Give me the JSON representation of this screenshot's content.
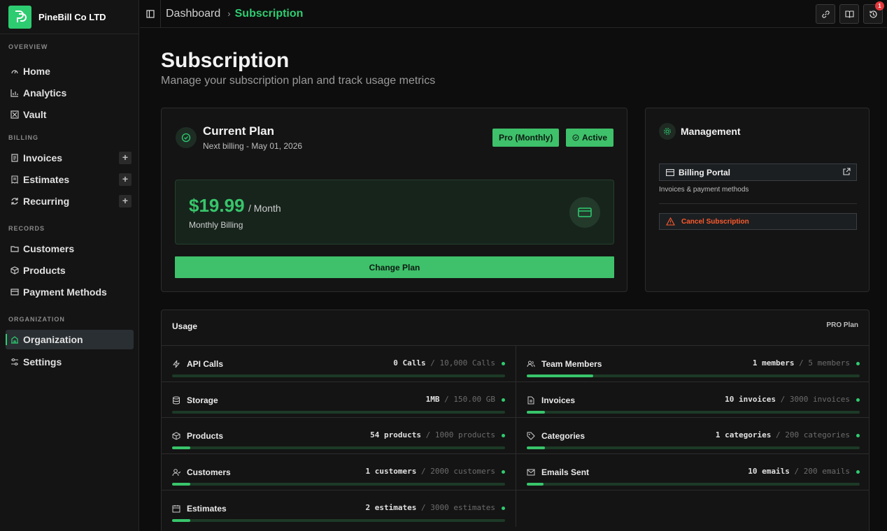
{
  "brand": {
    "name": "PineBill Co LTD"
  },
  "sidebar": {
    "sections": [
      {
        "title": "OVERVIEW",
        "items": [
          {
            "label": "Home",
            "icon": "gauge-icon"
          },
          {
            "label": "Analytics",
            "icon": "bar-chart-icon"
          },
          {
            "label": "Vault",
            "icon": "vault-icon"
          }
        ]
      },
      {
        "title": "BILLING",
        "items": [
          {
            "label": "Invoices",
            "icon": "file-icon",
            "add": "+"
          },
          {
            "label": "Estimates",
            "icon": "receipt-icon",
            "add": "+"
          },
          {
            "label": "Recurring",
            "icon": "refresh-icon",
            "add": "+"
          }
        ]
      },
      {
        "title": "RECORDS",
        "items": [
          {
            "label": "Customers",
            "icon": "folder-icon"
          },
          {
            "label": "Products",
            "icon": "box-icon"
          },
          {
            "label": "Payment Methods",
            "icon": "card-icon"
          }
        ]
      },
      {
        "title": "ORGANIZATION",
        "items": [
          {
            "label": "Organization",
            "icon": "building-icon",
            "active": true
          },
          {
            "label": "Settings",
            "icon": "sliders-icon"
          }
        ]
      }
    ]
  },
  "topbar": {
    "breadcrumb": {
      "home": "Dashboard",
      "separator": "›",
      "current": "Subscription"
    },
    "notification_count": "1"
  },
  "page": {
    "title": "Subscription",
    "subtitle": "Manage your subscription plan and track usage metrics"
  },
  "plan": {
    "title": "Current Plan",
    "next_billing": "Next billing - May 01, 2026",
    "plan_tag": "Pro (Monthly)",
    "status_tag": "Active",
    "price": "$19.99",
    "period": "/ Month",
    "billing_label": "Monthly Billing",
    "change_button": "Change Plan"
  },
  "management": {
    "title": "Management",
    "portal_button": "Billing Portal",
    "portal_desc": "Invoices & payment methods",
    "cancel_button": "Cancel Subscription"
  },
  "usage": {
    "title": "Usage",
    "plan_label": "PRO Plan",
    "metrics": [
      {
        "label": "API Calls",
        "icon": "bolt-icon",
        "value": "0 Calls",
        "limit": "10,000 Calls",
        "fraction": 0.0
      },
      {
        "label": "Team Members",
        "icon": "users-icon",
        "value": "1 members",
        "limit": "5 members",
        "fraction": 0.2
      },
      {
        "label": "Storage",
        "icon": "database-icon",
        "value": "1MB",
        "limit": "150.00 GB",
        "fraction": 0.0
      },
      {
        "label": "Invoices",
        "icon": "file-icon",
        "value": "10 invoices",
        "limit": "3000 invoices",
        "fraction": 0.003
      },
      {
        "label": "Products",
        "icon": "box-icon",
        "value": "54 products",
        "limit": "1000 products",
        "fraction": 0.054
      },
      {
        "label": "Categories",
        "icon": "tag-icon",
        "value": "1 categories",
        "limit": "200 categories",
        "fraction": 0.005
      },
      {
        "label": "Customers",
        "icon": "user-icon",
        "value": "1 customers",
        "limit": "2000 customers",
        "fraction": 0.0005
      },
      {
        "label": "Emails Sent",
        "icon": "mail-icon",
        "value": "10 emails",
        "limit": "200 emails",
        "fraction": 0.05
      },
      {
        "label": "Estimates",
        "icon": "receipt-icon",
        "value": "2 estimates",
        "limit": "3000 estimates",
        "fraction": 0.0007
      }
    ]
  },
  "colors": {
    "accent": "#2ecc71",
    "danger": "#ff5a2c",
    "badge": "#e5383b"
  }
}
